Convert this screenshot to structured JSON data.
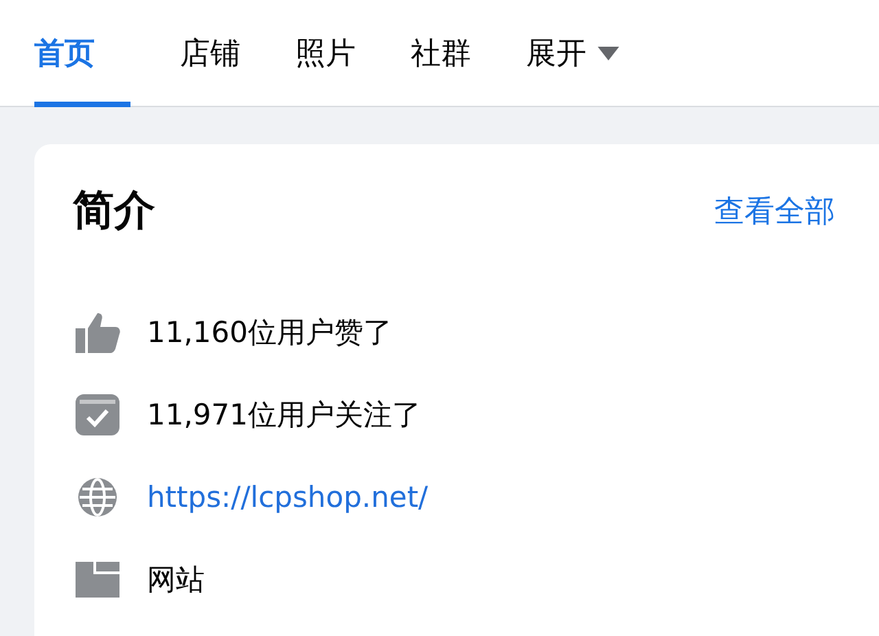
{
  "tabs": [
    {
      "label": "首页",
      "selected": true
    },
    {
      "label": "店铺",
      "selected": false
    },
    {
      "label": "照片",
      "selected": false
    },
    {
      "label": "社群",
      "selected": false
    },
    {
      "label": "展开",
      "selected": false,
      "kind": "dropdown"
    }
  ],
  "intro": {
    "title": "简介",
    "see_all": "查看全部",
    "rows": [
      {
        "kind": "likes",
        "text": "11,160位用户赞了"
      },
      {
        "kind": "followers",
        "text": "11,971位用户关注了"
      },
      {
        "kind": "link",
        "text": "https://lcpshop.net/"
      },
      {
        "kind": "website",
        "text": "网站"
      }
    ]
  }
}
